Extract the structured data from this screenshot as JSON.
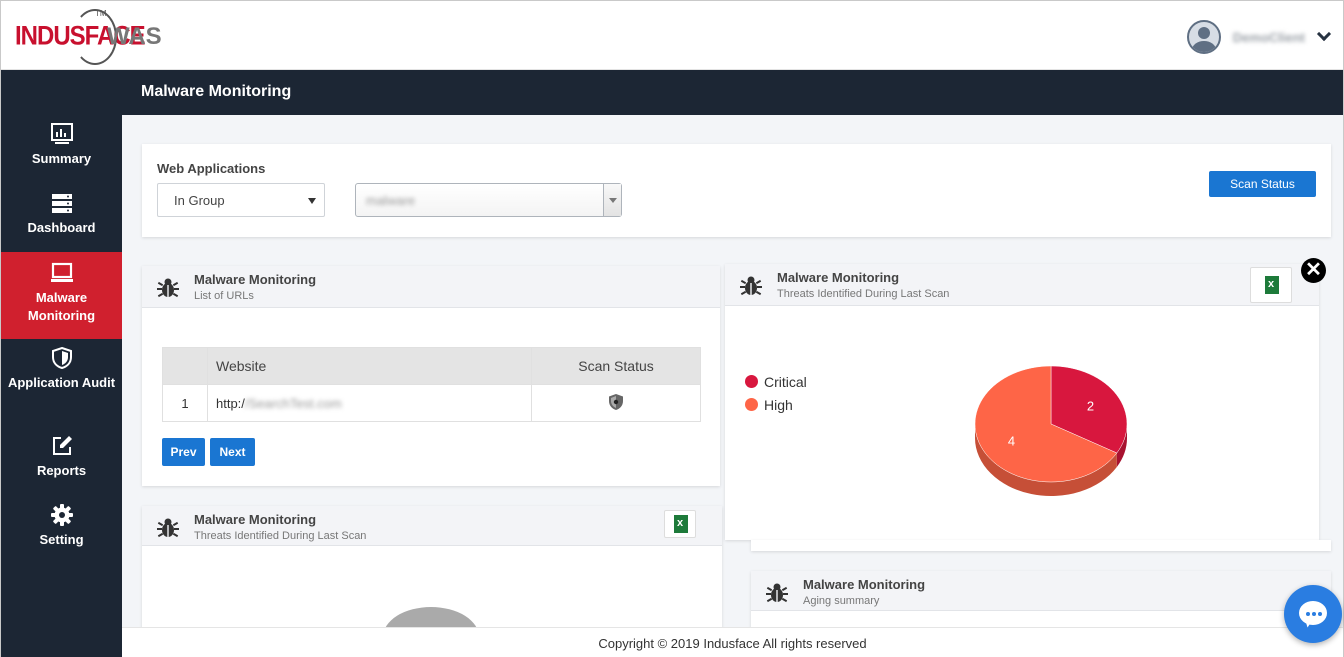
{
  "header": {
    "logo_brand": "INDUSFACE",
    "logo_tm": "TM",
    "logo_suffix": "WAS",
    "user_name": "DemoClient"
  },
  "page_title": "Malware Monitoring",
  "sidebar": {
    "items": [
      {
        "label": "Summary",
        "icon": "summary-icon",
        "active": false
      },
      {
        "label": "Dashboard",
        "icon": "dashboard-icon",
        "active": false
      },
      {
        "label": "Malware Monitoring",
        "icon": "monitor-icon",
        "active": true
      },
      {
        "label": "Application Audit",
        "icon": "shield-icon",
        "active": false
      },
      {
        "label": "Reports",
        "icon": "edit-icon",
        "active": false
      },
      {
        "label": "Setting",
        "icon": "gear-icon",
        "active": false
      }
    ]
  },
  "filter": {
    "label": "Web Applications",
    "group_select": "In Group",
    "app_select": "malware",
    "scan_status_button": "Scan Status"
  },
  "urls_panel": {
    "title": "Malware Monitoring",
    "subtitle": "List of URLs",
    "columns": [
      "Website",
      "Scan Status"
    ],
    "rows": [
      {
        "index": "1",
        "website_prefix": "http:/",
        "website_rest": "/SearchTest.com"
      }
    ],
    "prev_button": "Prev",
    "next_button": "Next"
  },
  "threats_panel_right": {
    "title": "Malware Monitoring",
    "subtitle": "Threats Identified During Last Scan",
    "excel_icon": "excel-icon",
    "excel_label": "x",
    "legend": [
      {
        "label": "Critical",
        "color": "#d8173e"
      },
      {
        "label": "High",
        "color": "#fe6547"
      }
    ]
  },
  "threats_panel_left": {
    "title": "Malware Monitoring",
    "subtitle": "Threats Identified During Last Scan",
    "excel_label": "x"
  },
  "aging_panel": {
    "title": "Malware Monitoring",
    "subtitle": "Aging summary"
  },
  "close_label": "✕",
  "footer": "Copyright © 2019 Indusface All rights reserved",
  "chart_data": {
    "type": "pie",
    "categories": [
      "Critical",
      "High"
    ],
    "values": [
      2,
      4
    ],
    "colors": [
      "#d8173e",
      "#fe6547"
    ],
    "legend": "left"
  }
}
